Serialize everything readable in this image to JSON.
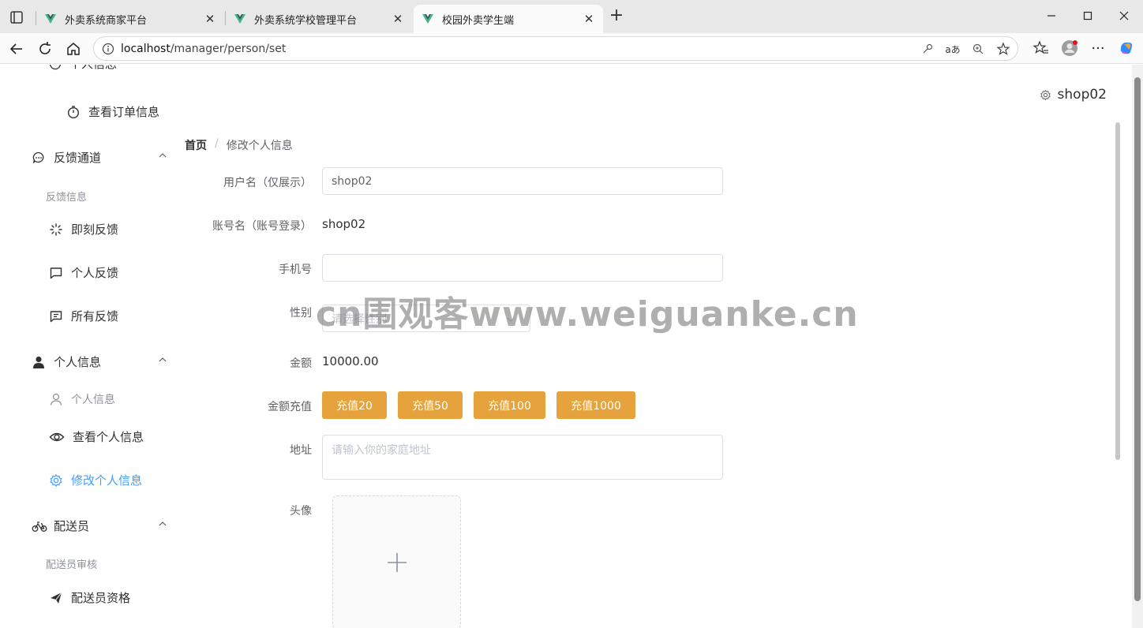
{
  "browser": {
    "tabs": [
      {
        "title": "外卖系统商家平台"
      },
      {
        "title": "外卖系统学校管理平台"
      },
      {
        "title": "校园外卖学生端"
      }
    ],
    "url_host": "localhost",
    "url_path": "/manager/person/set"
  },
  "header": {
    "username": "shop02"
  },
  "sidebar": {
    "partial_top": "个人信息",
    "items": {
      "view_orders": "查看订单信息",
      "feedback_group": "反馈通道",
      "feedback_subhead": "反馈信息",
      "instant_feedback": "即刻反馈",
      "personal_feedback": "个人反馈",
      "all_feedback": "所有反馈",
      "personal_group": "个人信息",
      "personal_subhead": "个人信息",
      "view_personal": "查看个人信息",
      "edit_personal": "修改个人信息",
      "courier_group": "配送员",
      "courier_subhead": "配送员审核",
      "courier_qualification": "配送员资格"
    }
  },
  "breadcrumb": {
    "home": "首页",
    "current": "修改个人信息"
  },
  "form": {
    "username_label": "用户名（仅展示）",
    "username_value": "shop02",
    "account_label": "账号名（账号登录）",
    "account_value": "shop02",
    "phone_label": "手机号",
    "phone_value": "",
    "gender_label": "性别",
    "gender_placeholder": "请选择性别",
    "balance_label": "金额",
    "balance_value": "10000.00",
    "recharge_label": "金额充值",
    "recharge_buttons": [
      "充值20",
      "充值50",
      "充值100",
      "充值1000"
    ],
    "address_label": "地址",
    "address_placeholder": "请输入你的家庭地址",
    "avatar_label": "头像"
  },
  "watermark": "cn围观客www.weiguanke.cn",
  "colors": {
    "accent": "#409eff",
    "warning": "#e6a23c"
  }
}
